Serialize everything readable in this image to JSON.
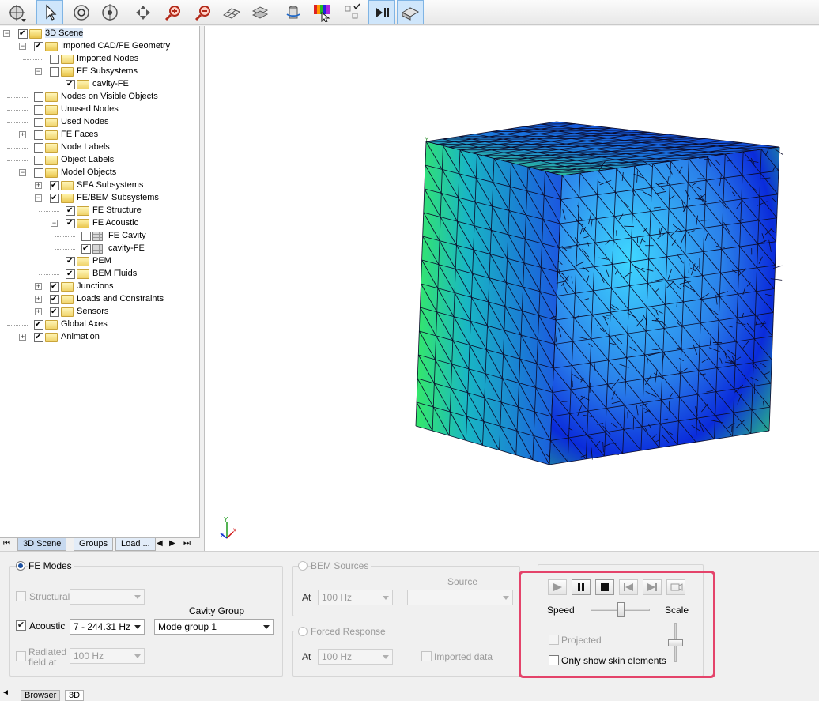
{
  "toolbar": {
    "buttons": [
      {
        "icon": "crosshair-dropdown-icon"
      },
      {
        "icon": "select-pointer-icon",
        "active": true
      },
      {
        "icon": "rotate-icon"
      },
      {
        "icon": "rotate-center-icon"
      },
      {
        "icon": "pan-icon"
      },
      {
        "icon": "zoom-in-icon"
      },
      {
        "icon": "zoom-out-icon"
      },
      {
        "icon": "mesh-grid-icon"
      },
      {
        "icon": "layers-icon"
      },
      {
        "icon": "cylinder-rotate-icon"
      },
      {
        "icon": "color-palette-icon"
      },
      {
        "icon": "node-select-icon"
      },
      {
        "icon": "play-pause-icon",
        "active": true
      },
      {
        "icon": "view-plane-icon",
        "active": true
      }
    ]
  },
  "tree": {
    "items": [
      {
        "label": "3D Scene",
        "level": 0,
        "checked": true,
        "expander": "minus",
        "icon": "folder-open"
      },
      {
        "label": "Imported CAD/FE Geometry",
        "level": 1,
        "checked": true,
        "expander": "minus",
        "icon": "folder-open"
      },
      {
        "label": "Imported Nodes",
        "level": 2,
        "checked": false,
        "expander": "",
        "icon": "folder"
      },
      {
        "label": "FE Subsystems",
        "level": 2,
        "checked": false,
        "expander": "minus",
        "icon": "folder-open"
      },
      {
        "label": "cavity-FE",
        "level": 3,
        "checked": true,
        "expander": "",
        "icon": "folder"
      },
      {
        "label": "Nodes on Visible Objects",
        "level": 1,
        "checked": false,
        "expander": "",
        "icon": "folder"
      },
      {
        "label": "Unused Nodes",
        "level": 1,
        "checked": false,
        "expander": "",
        "icon": "folder"
      },
      {
        "label": "Used Nodes",
        "level": 1,
        "checked": false,
        "expander": "",
        "icon": "folder"
      },
      {
        "label": "FE Faces",
        "level": 1,
        "checked": false,
        "expander": "plus",
        "icon": "folder"
      },
      {
        "label": "Node Labels",
        "level": 1,
        "checked": false,
        "expander": "",
        "icon": "folder"
      },
      {
        "label": "Object Labels",
        "level": 1,
        "checked": false,
        "expander": "",
        "icon": "folder"
      },
      {
        "label": "Model Objects",
        "level": 1,
        "checked": false,
        "expander": "minus",
        "icon": "folder-open"
      },
      {
        "label": "SEA Subsystems",
        "level": 2,
        "checked": true,
        "expander": "plus",
        "icon": "folder"
      },
      {
        "label": "FE/BEM Subsystems",
        "level": 2,
        "checked": true,
        "expander": "minus",
        "icon": "folder-open"
      },
      {
        "label": "FE Structure",
        "level": 3,
        "checked": true,
        "expander": "",
        "icon": "folder"
      },
      {
        "label": "FE Acoustic",
        "level": 3,
        "checked": true,
        "expander": "minus",
        "icon": "folder-open"
      },
      {
        "label": "FE Cavity",
        "level": 4,
        "checked": false,
        "expander": "",
        "icon": "grid"
      },
      {
        "label": "cavity-FE",
        "level": 4,
        "checked": true,
        "expander": "",
        "icon": "grid"
      },
      {
        "label": "PEM",
        "level": 3,
        "checked": true,
        "expander": "",
        "icon": "folder"
      },
      {
        "label": "BEM Fluids",
        "level": 3,
        "checked": true,
        "expander": "",
        "icon": "folder"
      },
      {
        "label": "Junctions",
        "level": 2,
        "checked": true,
        "expander": "plus",
        "icon": "folder"
      },
      {
        "label": "Loads and Constraints",
        "level": 2,
        "checked": true,
        "expander": "plus",
        "icon": "folder"
      },
      {
        "label": "Sensors",
        "level": 2,
        "checked": true,
        "expander": "plus",
        "icon": "folder"
      },
      {
        "label": "Global Axes",
        "level": 1,
        "checked": true,
        "expander": "",
        "icon": "folder"
      },
      {
        "label": "Animation",
        "level": 1,
        "checked": true,
        "expander": "plus",
        "icon": "folder"
      }
    ],
    "tabs": [
      "3D Scene",
      "Groups",
      "Load ..."
    ]
  },
  "view3d": {
    "colors": {
      "high": "#35e86a",
      "mid": "#3fd7ff",
      "low": "#0a2bdb"
    },
    "axis_labels": {
      "y": "Y",
      "z": "z",
      "x": "x"
    },
    "corner_axis_label": "Y"
  },
  "fe_modes": {
    "label": "FE Modes",
    "selected": true,
    "structural_label": "Structural",
    "structural_value": "",
    "acoustic_label": "Acoustic",
    "acoustic_checked": true,
    "acoustic_value": "7 - 244.31 Hz",
    "cavity_group_label": "Cavity Group",
    "cavity_group_value": "Mode group 1",
    "radiated_label_1": "Radiated",
    "radiated_label_2": "field at",
    "radiated_value": "100 Hz"
  },
  "bem_sources": {
    "label": "BEM Sources",
    "at_label": "At",
    "at_value": "100 Hz",
    "source_label": "Source",
    "source_value": ""
  },
  "forced_response": {
    "label": "Forced Response",
    "at_label": "At",
    "at_value": "100 Hz",
    "imported_label": "Imported data"
  },
  "animation": {
    "speed_label": "Speed",
    "scale_label": "Scale",
    "speed_fraction": 0.5,
    "scale_fraction": 0.5,
    "projected_label": "Projected",
    "skin_label": "Only show skin elements",
    "buttons": [
      "play-icon",
      "pause-icon",
      "stop-icon",
      "step-back-icon",
      "step-forward-icon",
      "record-icon"
    ]
  },
  "statusbar": {
    "tabs": [
      "Browser",
      "3D"
    ]
  }
}
